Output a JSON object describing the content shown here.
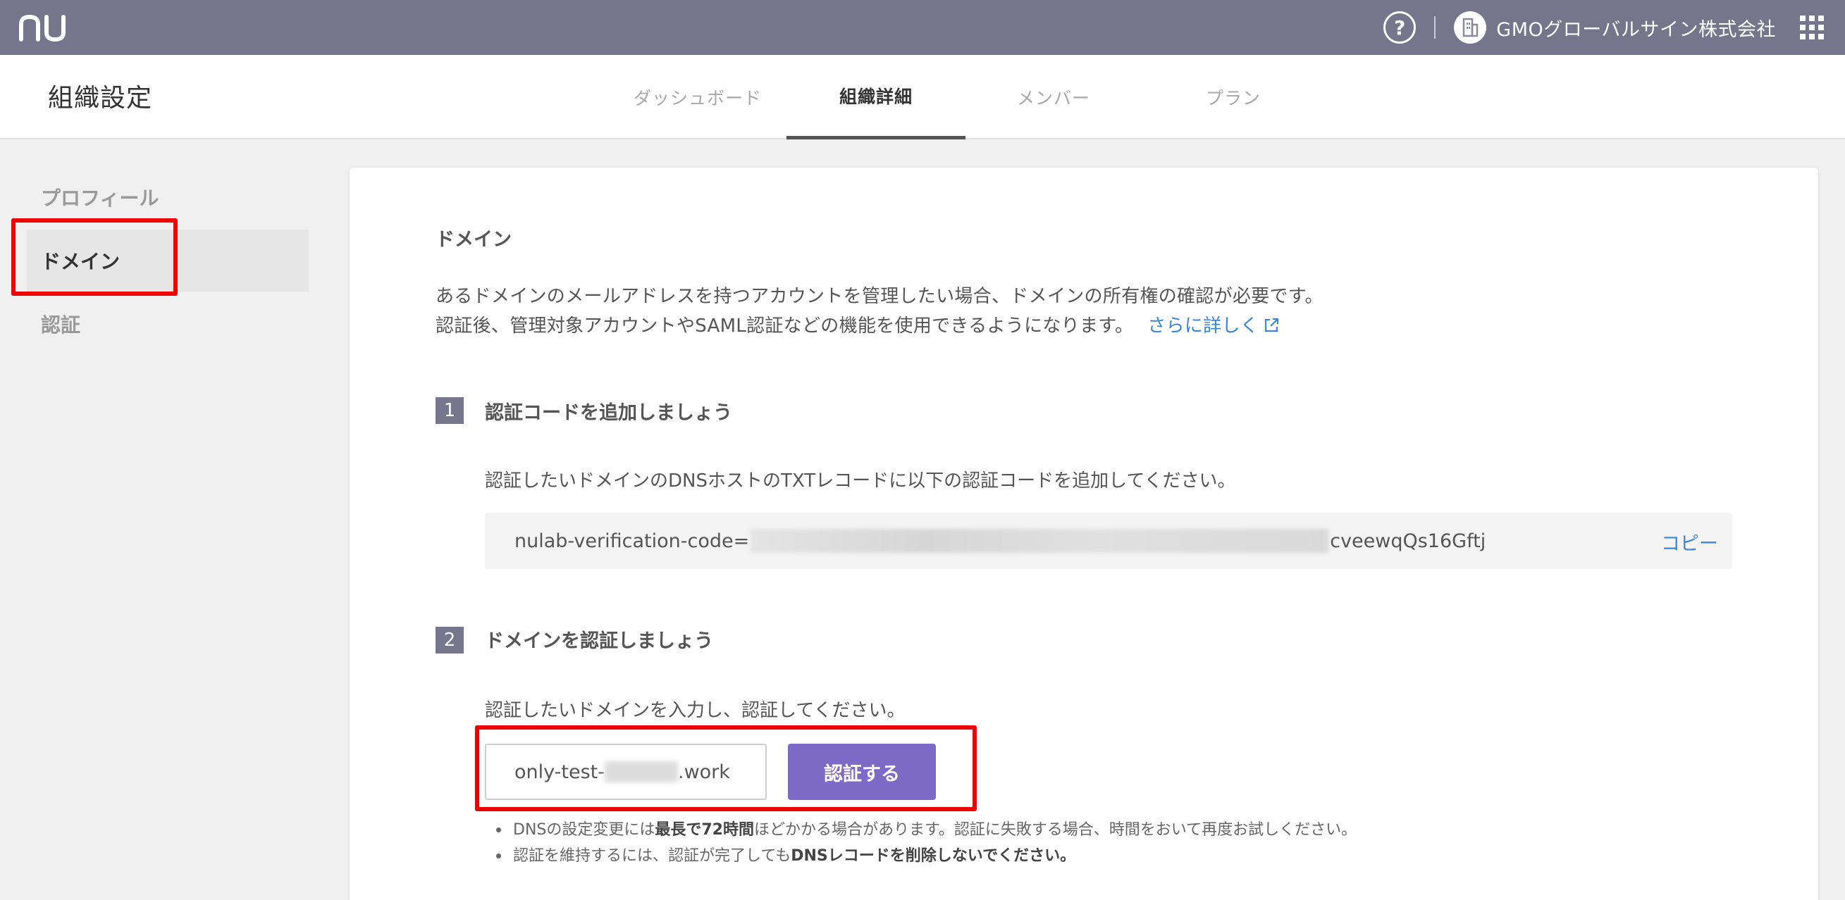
{
  "topbar": {
    "help_label": "?",
    "org_name": "GMOグローバルサイン株式会社"
  },
  "header": {
    "title": "組織設定",
    "tabs": [
      {
        "label": "ダッシュボード",
        "active": false
      },
      {
        "label": "組織詳細",
        "active": true
      },
      {
        "label": "メンバー",
        "active": false
      },
      {
        "label": "プラン",
        "active": false
      }
    ]
  },
  "sidebar": {
    "items": [
      {
        "label": "プロフィール",
        "active": false
      },
      {
        "label": "ドメイン",
        "active": true
      },
      {
        "label": "認証",
        "active": false
      }
    ]
  },
  "main": {
    "section_title": "ドメイン",
    "description_line1": "あるドメインのメールアドレスを持つアカウントを管理したい場合、ドメインの所有権の確認が必要です。",
    "description_line2": "認証後、管理対象アカウントやSAML認証などの機能を使用できるようになります。",
    "learn_more": "さらに詳しく",
    "step1": {
      "number": "1",
      "title": "認証コードを追加しましょう",
      "text": "認証したいドメインのDNSホストのTXTレコードに以下の認証コードを追加してください。",
      "code_prefix": "nulab-verification-code=",
      "code_suffix": "cveewqQs16Gftj",
      "copy_label": "コピー"
    },
    "step2": {
      "number": "2",
      "title": "ドメインを認証しましょう",
      "text": "認証したいドメインを入力し、認証してください。",
      "input_prefix": "only-test-",
      "input_suffix": ".work",
      "verify_label": "認証する"
    },
    "notes": {
      "note1_a": "DNSの設定変更には",
      "note1_b": "最長で72時間",
      "note1_c": "ほどかかる場合があります。認証に失敗する場合、時間をおいて再度お試しください。",
      "note2_a": "認証を維持するには、認証が完了しても",
      "note2_b": "DNSレコードを削除しないでください。"
    }
  },
  "colors": {
    "topbar": "#76758b",
    "accent_button": "#7d6ac7",
    "link": "#3b86d9",
    "highlight": "#ee0000"
  }
}
